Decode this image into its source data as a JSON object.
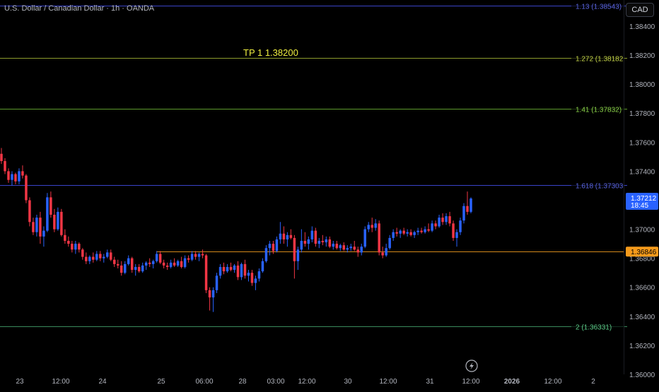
{
  "header": {
    "title": "U.S. Dollar / Canadian Dollar · 1h · OANDA",
    "currency_label": "CAD"
  },
  "annotations": {
    "tp_text": "TP 1 1.38200"
  },
  "chart_data": {
    "type": "candlestick",
    "symbol": "U.S. Dollar / Canadian Dollar",
    "interval": "1h",
    "source": "OANDA",
    "ylim": [
      1.36,
      1.3858
    ],
    "y_ticks": [
      "1.38400",
      "1.38200",
      "1.38000",
      "1.37800",
      "1.37600",
      "1.37400",
      "1.37000",
      "1.36800",
      "1.36600",
      "1.36400",
      "1.36200",
      "1.36000"
    ],
    "x_ticks": [
      "23",
      "12:00",
      "24",
      "25",
      "06:00",
      "28",
      "03:00",
      "12:00",
      "30",
      "12:00",
      "31",
      "12:00",
      "2026",
      "12:00",
      "2"
    ],
    "x_tick_major": [
      false,
      false,
      false,
      false,
      false,
      false,
      false,
      false,
      false,
      false,
      false,
      false,
      true,
      false,
      false
    ],
    "horizontal_levels": [
      {
        "label": "1.13 (1.38543)",
        "price": 1.38543,
        "color": "#3a44c8",
        "text_color": "#5b66e0"
      },
      {
        "label": "1.272 (1.38182",
        "price": 1.38182,
        "color": "#8c9a2c",
        "text_color": "#c6d64a"
      },
      {
        "label": "1.41 (1.37832)",
        "price": 1.37832,
        "color": "#5c9a2c",
        "text_color": "#8ad24a"
      },
      {
        "label": "1.618 (1.37303",
        "price": 1.37303,
        "color": "#3a44c8",
        "text_color": "#5b66e0"
      },
      {
        "label": "2 (1.36331)",
        "price": 1.36331,
        "color": "#3a8a5c",
        "text_color": "#5ccc88"
      }
    ],
    "tp_level": {
      "price": 1.382,
      "color": "#f0f040"
    },
    "support_line": {
      "price": 1.36846,
      "color": "#d4891a"
    },
    "price_badges": [
      {
        "value": "1.37212",
        "sub": "18:45",
        "color": "#2962ff"
      },
      {
        "value": "1.36846",
        "color": "#f59a1b"
      }
    ],
    "candles": [
      {
        "o": 1.3752,
        "h": 1.3756,
        "l": 1.3745,
        "c": 1.3747
      },
      {
        "o": 1.3747,
        "h": 1.3749,
        "l": 1.3738,
        "c": 1.374
      },
      {
        "o": 1.374,
        "h": 1.3742,
        "l": 1.3732,
        "c": 1.3734
      },
      {
        "o": 1.3734,
        "h": 1.374,
        "l": 1.373,
        "c": 1.3738
      },
      {
        "o": 1.3738,
        "h": 1.3739,
        "l": 1.3731,
        "c": 1.3733
      },
      {
        "o": 1.3733,
        "h": 1.3742,
        "l": 1.3731,
        "c": 1.374
      },
      {
        "o": 1.374,
        "h": 1.3744,
        "l": 1.3735,
        "c": 1.3737
      },
      {
        "o": 1.3737,
        "h": 1.3738,
        "l": 1.3718,
        "c": 1.372
      },
      {
        "o": 1.372,
        "h": 1.3722,
        "l": 1.3702,
        "c": 1.3705
      },
      {
        "o": 1.3705,
        "h": 1.3708,
        "l": 1.3696,
        "c": 1.3698
      },
      {
        "o": 1.3698,
        "h": 1.371,
        "l": 1.3695,
        "c": 1.3708
      },
      {
        "o": 1.3708,
        "h": 1.3712,
        "l": 1.369,
        "c": 1.3695
      },
      {
        "o": 1.3695,
        "h": 1.3702,
        "l": 1.3688,
        "c": 1.3699
      },
      {
        "o": 1.3699,
        "h": 1.3725,
        "l": 1.3698,
        "c": 1.3722
      },
      {
        "o": 1.3722,
        "h": 1.3726,
        "l": 1.3708,
        "c": 1.371
      },
      {
        "o": 1.371,
        "h": 1.3714,
        "l": 1.3698,
        "c": 1.37
      },
      {
        "o": 1.37,
        "h": 1.3715,
        "l": 1.3699,
        "c": 1.3712
      },
      {
        "o": 1.3712,
        "h": 1.3714,
        "l": 1.3695,
        "c": 1.3696
      },
      {
        "o": 1.3696,
        "h": 1.37,
        "l": 1.369,
        "c": 1.3692
      },
      {
        "o": 1.3692,
        "h": 1.3695,
        "l": 1.3688,
        "c": 1.369
      },
      {
        "o": 1.369,
        "h": 1.3692,
        "l": 1.3684,
        "c": 1.3686
      },
      {
        "o": 1.3686,
        "h": 1.3692,
        "l": 1.3683,
        "c": 1.369
      },
      {
        "o": 1.369,
        "h": 1.3691,
        "l": 1.3684,
        "c": 1.3686
      },
      {
        "o": 1.3686,
        "h": 1.3687,
        "l": 1.3679,
        "c": 1.3681
      },
      {
        "o": 1.3681,
        "h": 1.3684,
        "l": 1.3676,
        "c": 1.3678
      },
      {
        "o": 1.3678,
        "h": 1.3682,
        "l": 1.3676,
        "c": 1.3681
      },
      {
        "o": 1.3681,
        "h": 1.3684,
        "l": 1.3677,
        "c": 1.3679
      },
      {
        "o": 1.3679,
        "h": 1.3685,
        "l": 1.3678,
        "c": 1.3683
      },
      {
        "o": 1.3683,
        "h": 1.3685,
        "l": 1.3678,
        "c": 1.368
      },
      {
        "o": 1.368,
        "h": 1.3683,
        "l": 1.3677,
        "c": 1.3681
      },
      {
        "o": 1.3681,
        "h": 1.3686,
        "l": 1.368,
        "c": 1.3684
      },
      {
        "o": 1.3684,
        "h": 1.3686,
        "l": 1.3678,
        "c": 1.3679
      },
      {
        "o": 1.3679,
        "h": 1.3681,
        "l": 1.3674,
        "c": 1.3676
      },
      {
        "o": 1.3676,
        "h": 1.3679,
        "l": 1.3673,
        "c": 1.3675
      },
      {
        "o": 1.3675,
        "h": 1.3678,
        "l": 1.3668,
        "c": 1.367
      },
      {
        "o": 1.367,
        "h": 1.3678,
        "l": 1.3669,
        "c": 1.3676
      },
      {
        "o": 1.3676,
        "h": 1.3682,
        "l": 1.3675,
        "c": 1.368
      },
      {
        "o": 1.368,
        "h": 1.3681,
        "l": 1.367,
        "c": 1.3672
      },
      {
        "o": 1.3672,
        "h": 1.3676,
        "l": 1.3668,
        "c": 1.3674
      },
      {
        "o": 1.3674,
        "h": 1.3676,
        "l": 1.367,
        "c": 1.3671
      },
      {
        "o": 1.3671,
        "h": 1.3677,
        "l": 1.367,
        "c": 1.3675
      },
      {
        "o": 1.3675,
        "h": 1.3678,
        "l": 1.3672,
        "c": 1.3677
      },
      {
        "o": 1.3677,
        "h": 1.368,
        "l": 1.3674,
        "c": 1.3676
      },
      {
        "o": 1.3676,
        "h": 1.3679,
        "l": 1.3673,
        "c": 1.3678
      },
      {
        "o": 1.3678,
        "h": 1.3685,
        "l": 1.3677,
        "c": 1.3683
      },
      {
        "o": 1.3683,
        "h": 1.3685,
        "l": 1.3676,
        "c": 1.3677
      },
      {
        "o": 1.3677,
        "h": 1.3679,
        "l": 1.3673,
        "c": 1.3675
      },
      {
        "o": 1.3675,
        "h": 1.3677,
        "l": 1.3672,
        "c": 1.3674
      },
      {
        "o": 1.3674,
        "h": 1.3679,
        "l": 1.3673,
        "c": 1.3677
      },
      {
        "o": 1.3677,
        "h": 1.368,
        "l": 1.3674,
        "c": 1.3675
      },
      {
        "o": 1.3675,
        "h": 1.3679,
        "l": 1.3674,
        "c": 1.3678
      },
      {
        "o": 1.3678,
        "h": 1.3681,
        "l": 1.3673,
        "c": 1.3674
      },
      {
        "o": 1.3674,
        "h": 1.3682,
        "l": 1.3673,
        "c": 1.368
      },
      {
        "o": 1.368,
        "h": 1.3682,
        "l": 1.3677,
        "c": 1.3679
      },
      {
        "o": 1.3679,
        "h": 1.3685,
        "l": 1.3678,
        "c": 1.3683
      },
      {
        "o": 1.3683,
        "h": 1.3685,
        "l": 1.3679,
        "c": 1.3681
      },
      {
        "o": 1.3681,
        "h": 1.3684,
        "l": 1.3678,
        "c": 1.3683
      },
      {
        "o": 1.3683,
        "h": 1.3686,
        "l": 1.368,
        "c": 1.3682
      },
      {
        "o": 1.3682,
        "h": 1.3683,
        "l": 1.3656,
        "c": 1.3658
      },
      {
        "o": 1.3658,
        "h": 1.366,
        "l": 1.3644,
        "c": 1.3653
      },
      {
        "o": 1.3653,
        "h": 1.366,
        "l": 1.3643,
        "c": 1.3658
      },
      {
        "o": 1.3658,
        "h": 1.367,
        "l": 1.3656,
        "c": 1.3668
      },
      {
        "o": 1.3668,
        "h": 1.3676,
        "l": 1.3666,
        "c": 1.3674
      },
      {
        "o": 1.3674,
        "h": 1.3677,
        "l": 1.3669,
        "c": 1.3671
      },
      {
        "o": 1.3671,
        "h": 1.3676,
        "l": 1.367,
        "c": 1.3674
      },
      {
        "o": 1.3674,
        "h": 1.3677,
        "l": 1.3671,
        "c": 1.3672
      },
      {
        "o": 1.3672,
        "h": 1.3676,
        "l": 1.367,
        "c": 1.3675
      },
      {
        "o": 1.3675,
        "h": 1.3678,
        "l": 1.3665,
        "c": 1.3667
      },
      {
        "o": 1.3667,
        "h": 1.3677,
        "l": 1.3665,
        "c": 1.3676
      },
      {
        "o": 1.3676,
        "h": 1.3679,
        "l": 1.3666,
        "c": 1.3668
      },
      {
        "o": 1.3668,
        "h": 1.3672,
        "l": 1.3664,
        "c": 1.367
      },
      {
        "o": 1.367,
        "h": 1.3672,
        "l": 1.3661,
        "c": 1.3663
      },
      {
        "o": 1.3663,
        "h": 1.3668,
        "l": 1.3658,
        "c": 1.3666
      },
      {
        "o": 1.3666,
        "h": 1.3673,
        "l": 1.3664,
        "c": 1.3671
      },
      {
        "o": 1.3671,
        "h": 1.368,
        "l": 1.367,
        "c": 1.3678
      },
      {
        "o": 1.3678,
        "h": 1.3689,
        "l": 1.3677,
        "c": 1.3687
      },
      {
        "o": 1.3687,
        "h": 1.3692,
        "l": 1.3682,
        "c": 1.369
      },
      {
        "o": 1.369,
        "h": 1.3692,
        "l": 1.3683,
        "c": 1.3685
      },
      {
        "o": 1.3685,
        "h": 1.3695,
        "l": 1.3684,
        "c": 1.3693
      },
      {
        "o": 1.3693,
        "h": 1.3705,
        "l": 1.369,
        "c": 1.3697
      },
      {
        "o": 1.3697,
        "h": 1.3702,
        "l": 1.369,
        "c": 1.3693
      },
      {
        "o": 1.3693,
        "h": 1.3698,
        "l": 1.3688,
        "c": 1.3696
      },
      {
        "o": 1.3696,
        "h": 1.37,
        "l": 1.3693,
        "c": 1.3694
      },
      {
        "o": 1.3694,
        "h": 1.3696,
        "l": 1.3666,
        "c": 1.3678
      },
      {
        "o": 1.3678,
        "h": 1.3688,
        "l": 1.3672,
        "c": 1.3686
      },
      {
        "o": 1.3686,
        "h": 1.37,
        "l": 1.3684,
        "c": 1.3692
      },
      {
        "o": 1.3692,
        "h": 1.3698,
        "l": 1.3688,
        "c": 1.369
      },
      {
        "o": 1.369,
        "h": 1.3695,
        "l": 1.3686,
        "c": 1.3693
      },
      {
        "o": 1.3693,
        "h": 1.3702,
        "l": 1.3691,
        "c": 1.3699
      },
      {
        "o": 1.3699,
        "h": 1.3701,
        "l": 1.3688,
        "c": 1.369
      },
      {
        "o": 1.369,
        "h": 1.3694,
        "l": 1.3687,
        "c": 1.3692
      },
      {
        "o": 1.3692,
        "h": 1.3696,
        "l": 1.3689,
        "c": 1.3691
      },
      {
        "o": 1.3691,
        "h": 1.3695,
        "l": 1.3688,
        "c": 1.3693
      },
      {
        "o": 1.3693,
        "h": 1.3695,
        "l": 1.3687,
        "c": 1.3688
      },
      {
        "o": 1.3688,
        "h": 1.3692,
        "l": 1.3686,
        "c": 1.369
      },
      {
        "o": 1.369,
        "h": 1.3692,
        "l": 1.3686,
        "c": 1.3687
      },
      {
        "o": 1.3687,
        "h": 1.369,
        "l": 1.3685,
        "c": 1.3689
      },
      {
        "o": 1.3689,
        "h": 1.3691,
        "l": 1.3685,
        "c": 1.3686
      },
      {
        "o": 1.3686,
        "h": 1.3689,
        "l": 1.3684,
        "c": 1.3687
      },
      {
        "o": 1.3687,
        "h": 1.369,
        "l": 1.3685,
        "c": 1.3688
      },
      {
        "o": 1.3688,
        "h": 1.3692,
        "l": 1.3685,
        "c": 1.3686
      },
      {
        "o": 1.3686,
        "h": 1.3688,
        "l": 1.3681,
        "c": 1.3684
      },
      {
        "o": 1.3684,
        "h": 1.369,
        "l": 1.3682,
        "c": 1.3688
      },
      {
        "o": 1.3688,
        "h": 1.3702,
        "l": 1.3687,
        "c": 1.37
      },
      {
        "o": 1.37,
        "h": 1.3705,
        "l": 1.3698,
        "c": 1.3703
      },
      {
        "o": 1.3703,
        "h": 1.3708,
        "l": 1.3698,
        "c": 1.3701
      },
      {
        "o": 1.3701,
        "h": 1.3707,
        "l": 1.3699,
        "c": 1.3704
      },
      {
        "o": 1.3704,
        "h": 1.3706,
        "l": 1.3682,
        "c": 1.3684
      },
      {
        "o": 1.3684,
        "h": 1.3688,
        "l": 1.368,
        "c": 1.3682
      },
      {
        "o": 1.3682,
        "h": 1.369,
        "l": 1.3681,
        "c": 1.3687
      },
      {
        "o": 1.3687,
        "h": 1.3696,
        "l": 1.3686,
        "c": 1.3694
      },
      {
        "o": 1.3694,
        "h": 1.37,
        "l": 1.3692,
        "c": 1.3698
      },
      {
        "o": 1.3698,
        "h": 1.3701,
        "l": 1.3695,
        "c": 1.3697
      },
      {
        "o": 1.3697,
        "h": 1.37,
        "l": 1.3694,
        "c": 1.3699
      },
      {
        "o": 1.3699,
        "h": 1.3701,
        "l": 1.3696,
        "c": 1.3697
      },
      {
        "o": 1.3697,
        "h": 1.37,
        "l": 1.3695,
        "c": 1.3698
      },
      {
        "o": 1.3698,
        "h": 1.37,
        "l": 1.3695,
        "c": 1.3696
      },
      {
        "o": 1.3696,
        "h": 1.3699,
        "l": 1.3694,
        "c": 1.3698
      },
      {
        "o": 1.3698,
        "h": 1.3701,
        "l": 1.3696,
        "c": 1.3699
      },
      {
        "o": 1.3699,
        "h": 1.3701,
        "l": 1.3697,
        "c": 1.3698
      },
      {
        "o": 1.3698,
        "h": 1.3702,
        "l": 1.3697,
        "c": 1.37
      },
      {
        "o": 1.37,
        "h": 1.3704,
        "l": 1.3698,
        "c": 1.3699
      },
      {
        "o": 1.3699,
        "h": 1.3706,
        "l": 1.3698,
        "c": 1.3704
      },
      {
        "o": 1.3704,
        "h": 1.3706,
        "l": 1.37,
        "c": 1.3702
      },
      {
        "o": 1.3702,
        "h": 1.371,
        "l": 1.3701,
        "c": 1.3708
      },
      {
        "o": 1.3708,
        "h": 1.3711,
        "l": 1.3703,
        "c": 1.3705
      },
      {
        "o": 1.3705,
        "h": 1.3711,
        "l": 1.3703,
        "c": 1.3709
      },
      {
        "o": 1.3709,
        "h": 1.3712,
        "l": 1.3702,
        "c": 1.3704
      },
      {
        "o": 1.3704,
        "h": 1.3706,
        "l": 1.3692,
        "c": 1.3694
      },
      {
        "o": 1.3694,
        "h": 1.37,
        "l": 1.3688,
        "c": 1.3698
      },
      {
        "o": 1.3698,
        "h": 1.3708,
        "l": 1.3696,
        "c": 1.3706
      },
      {
        "o": 1.3706,
        "h": 1.3718,
        "l": 1.3704,
        "c": 1.3716
      },
      {
        "o": 1.3716,
        "h": 1.3726,
        "l": 1.371,
        "c": 1.3712
      },
      {
        "o": 1.3712,
        "h": 1.3722,
        "l": 1.3711,
        "c": 1.37212
      }
    ]
  }
}
